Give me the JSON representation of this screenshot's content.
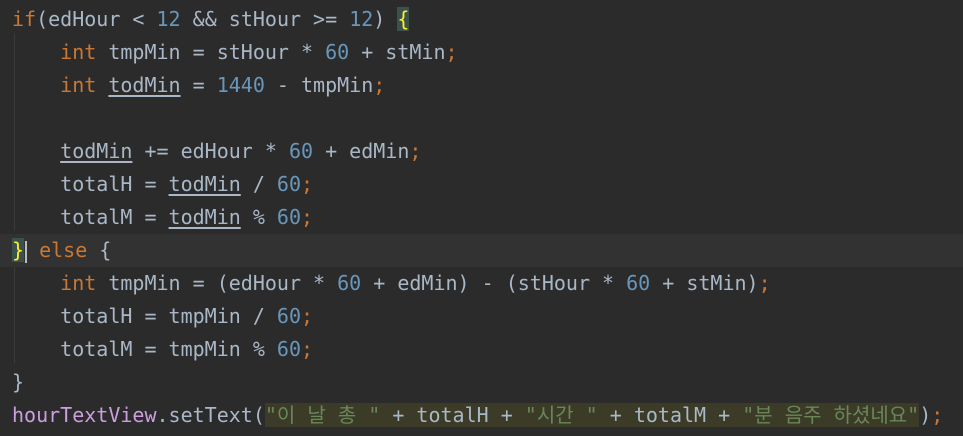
{
  "code": {
    "lines": [
      [
        {
          "t": "if",
          "c": "kw"
        },
        {
          "t": "(edHour < "
        },
        {
          "t": "12",
          "c": "num"
        },
        {
          "t": " && stHour >= "
        },
        {
          "t": "12",
          "c": "num"
        },
        {
          "t": ") "
        },
        {
          "t": "{",
          "c": "brace-match"
        }
      ],
      [
        {
          "t": "    "
        },
        {
          "t": "int",
          "c": "kw"
        },
        {
          "t": " tmpMin = stHour * "
        },
        {
          "t": "60",
          "c": "num"
        },
        {
          "t": " + stMin"
        },
        {
          "t": ";",
          "c": "punct"
        }
      ],
      [
        {
          "t": "    "
        },
        {
          "t": "int",
          "c": "kw"
        },
        {
          "t": " "
        },
        {
          "t": "todMin",
          "c": "ul"
        },
        {
          "t": " = "
        },
        {
          "t": "1440",
          "c": "num"
        },
        {
          "t": " - tmpMin"
        },
        {
          "t": ";",
          "c": "punct"
        }
      ],
      [],
      [
        {
          "t": "    "
        },
        {
          "t": "todMin",
          "c": "ul"
        },
        {
          "t": " += edHour * "
        },
        {
          "t": "60",
          "c": "num"
        },
        {
          "t": " + edMin"
        },
        {
          "t": ";",
          "c": "punct"
        }
      ],
      [
        {
          "t": "    totalH = "
        },
        {
          "t": "todMin",
          "c": "ul"
        },
        {
          "t": " / "
        },
        {
          "t": "60",
          "c": "num"
        },
        {
          "t": ";",
          "c": "punct"
        }
      ],
      [
        {
          "t": "    totalM = "
        },
        {
          "t": "todMin",
          "c": "ul"
        },
        {
          "t": " % "
        },
        {
          "t": "60",
          "c": "num"
        },
        {
          "t": ";",
          "c": "punct"
        }
      ],
      [
        {
          "t": "}",
          "c": "brace-match"
        },
        {
          "t": "",
          "c": "caret"
        },
        {
          "t": " "
        },
        {
          "t": "else",
          "c": "kw"
        },
        {
          "t": " {"
        }
      ],
      [
        {
          "t": "    "
        },
        {
          "t": "int",
          "c": "kw"
        },
        {
          "t": " tmpMin = (edHour * "
        },
        {
          "t": "60",
          "c": "num"
        },
        {
          "t": " + edMin) - (stHour * "
        },
        {
          "t": "60",
          "c": "num"
        },
        {
          "t": " + stMin)"
        },
        {
          "t": ";",
          "c": "punct"
        }
      ],
      [
        {
          "t": "    totalH = tmpMin / "
        },
        {
          "t": "60",
          "c": "num"
        },
        {
          "t": ";",
          "c": "punct"
        }
      ],
      [
        {
          "t": "    totalM = tmpMin % "
        },
        {
          "t": "60",
          "c": "num"
        },
        {
          "t": ";",
          "c": "punct"
        }
      ],
      [
        {
          "t": "}"
        }
      ],
      [
        {
          "t": "hourTextView",
          "c": "fn"
        },
        {
          "t": ".setText("
        },
        {
          "t": "\"이 날 총 \"",
          "c": "str strhl"
        },
        {
          "t": " + totalH + ",
          "c": "strhl"
        },
        {
          "t": "\"시간 \"",
          "c": "str strhl"
        },
        {
          "t": " + totalM + ",
          "c": "strhl"
        },
        {
          "t": "\"분 음주 하셨네요\"",
          "c": "str strhl"
        },
        {
          "t": ")"
        },
        {
          "t": ";",
          "c": "punct"
        }
      ]
    ]
  },
  "colors": {
    "background": "#2b2b2b",
    "text": "#a9b7c6",
    "keyword": "#cc7832",
    "number": "#6897bb",
    "string": "#6a8759",
    "method": "#cc9ee0"
  }
}
